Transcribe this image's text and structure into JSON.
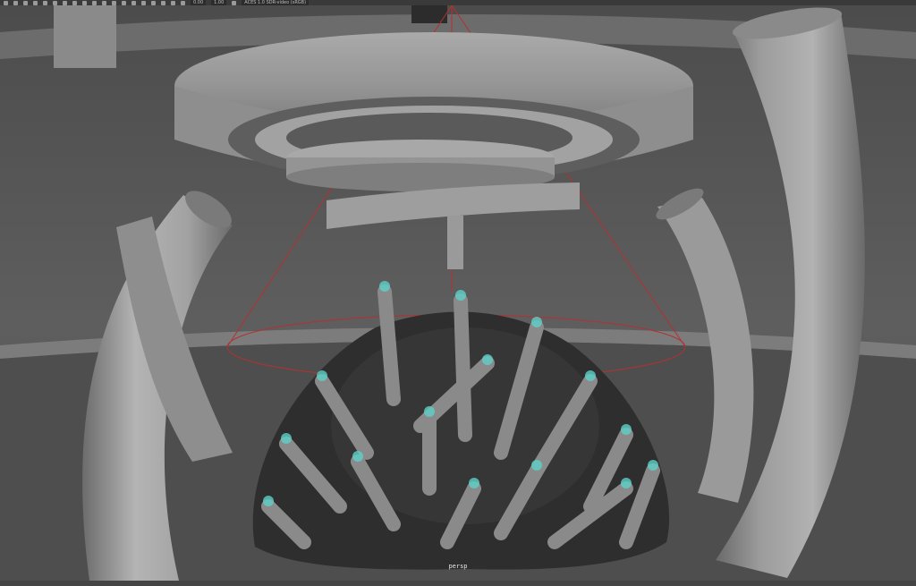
{
  "toolbar": {
    "field_1": "0.00",
    "field_2": "1.00",
    "colorspace": "ACES 1.0 SDR-video (sRGB)"
  },
  "viewport": {
    "camera_label": "persp"
  },
  "colors": {
    "background": "#5a5a5a",
    "surface_light": "#a9a9a9",
    "surface_shadow": "#6e6e6e",
    "mound": "#2e2e2e",
    "light_gizmo": "#c03030",
    "joint_highlight": "#5fd0c8"
  }
}
